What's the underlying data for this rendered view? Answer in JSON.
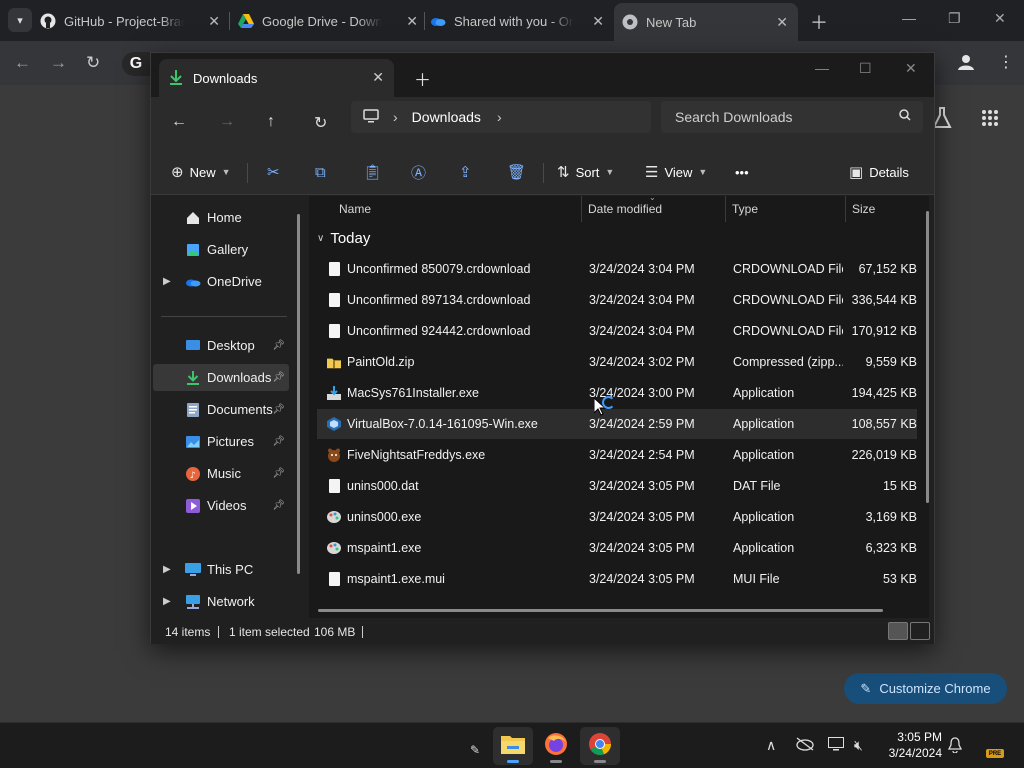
{
  "chrome": {
    "tabs": [
      {
        "label": "GitHub - Project-Brade",
        "icon": "github-icon"
      },
      {
        "label": "Google Drive - Downlo",
        "icon": "google-drive-icon"
      },
      {
        "label": "Shared with you - One",
        "icon": "onedrive-icon"
      },
      {
        "label": "New Tab",
        "icon": "chrome-icon",
        "active": true
      }
    ],
    "customize_label": "Customize Chrome"
  },
  "explorer": {
    "tab_title": "Downloads",
    "breadcrumb": [
      "Downloads"
    ],
    "search_placeholder": "Search Downloads",
    "commands": {
      "new": "New",
      "sort": "Sort",
      "view": "View",
      "more": "•••",
      "details": "Details"
    },
    "nav": {
      "home": "Home",
      "gallery": "Gallery",
      "onedrive": "OneDrive",
      "desktop": "Desktop",
      "downloads": "Downloads",
      "documents": "Documents",
      "pictures": "Pictures",
      "music": "Music",
      "videos": "Videos",
      "thispc": "This PC",
      "network": "Network"
    },
    "columns": {
      "name": "Name",
      "date": "Date modified",
      "type": "Type",
      "size": "Size"
    },
    "group": "Today",
    "files": [
      {
        "name": "Unconfirmed 850079.crdownload",
        "date": "3/24/2024 3:04 PM",
        "type": "CRDOWNLOAD File",
        "size": "67,152 KB"
      },
      {
        "name": "Unconfirmed 897134.crdownload",
        "date": "3/24/2024 3:04 PM",
        "type": "CRDOWNLOAD File",
        "size": "336,544 KB"
      },
      {
        "name": "Unconfirmed 924442.crdownload",
        "date": "3/24/2024 3:04 PM",
        "type": "CRDOWNLOAD File",
        "size": "170,912 KB"
      },
      {
        "name": "PaintOld.zip",
        "date": "3/24/2024 3:02 PM",
        "type": "Compressed (zipp...",
        "size": "9,559 KB"
      },
      {
        "name": "MacSys761Installer.exe",
        "date": "3/24/2024 3:00 PM",
        "type": "Application",
        "size": "194,425 KB"
      },
      {
        "name": "VirtualBox-7.0.14-161095-Win.exe",
        "date": "3/24/2024 2:59 PM",
        "type": "Application",
        "size": "108,557 KB"
      },
      {
        "name": "FiveNightsatFreddys.exe",
        "date": "3/24/2024 2:54 PM",
        "type": "Application",
        "size": "226,019 KB"
      },
      {
        "name": "unins000.dat",
        "date": "3/24/2024 3:05 PM",
        "type": "DAT File",
        "size": "15 KB"
      },
      {
        "name": "unins000.exe",
        "date": "3/24/2024 3:05 PM",
        "type": "Application",
        "size": "3,169 KB"
      },
      {
        "name": "mspaint1.exe",
        "date": "3/24/2024 3:05 PM",
        "type": "Application",
        "size": "6,323 KB"
      },
      {
        "name": "mspaint1.exe.mui",
        "date": "3/24/2024 3:05 PM",
        "type": "MUI File",
        "size": "53 KB"
      }
    ],
    "status": {
      "items": "14 items",
      "selected": "1 item selected",
      "size": "106 MB"
    }
  },
  "taskbar": {
    "time": "3:05 PM",
    "date": "3/24/2024",
    "badge": "PRE"
  },
  "colors": {
    "accent": "#4aa3ff",
    "customize_bg": "#174e7a",
    "folder": "#f2c94c"
  }
}
